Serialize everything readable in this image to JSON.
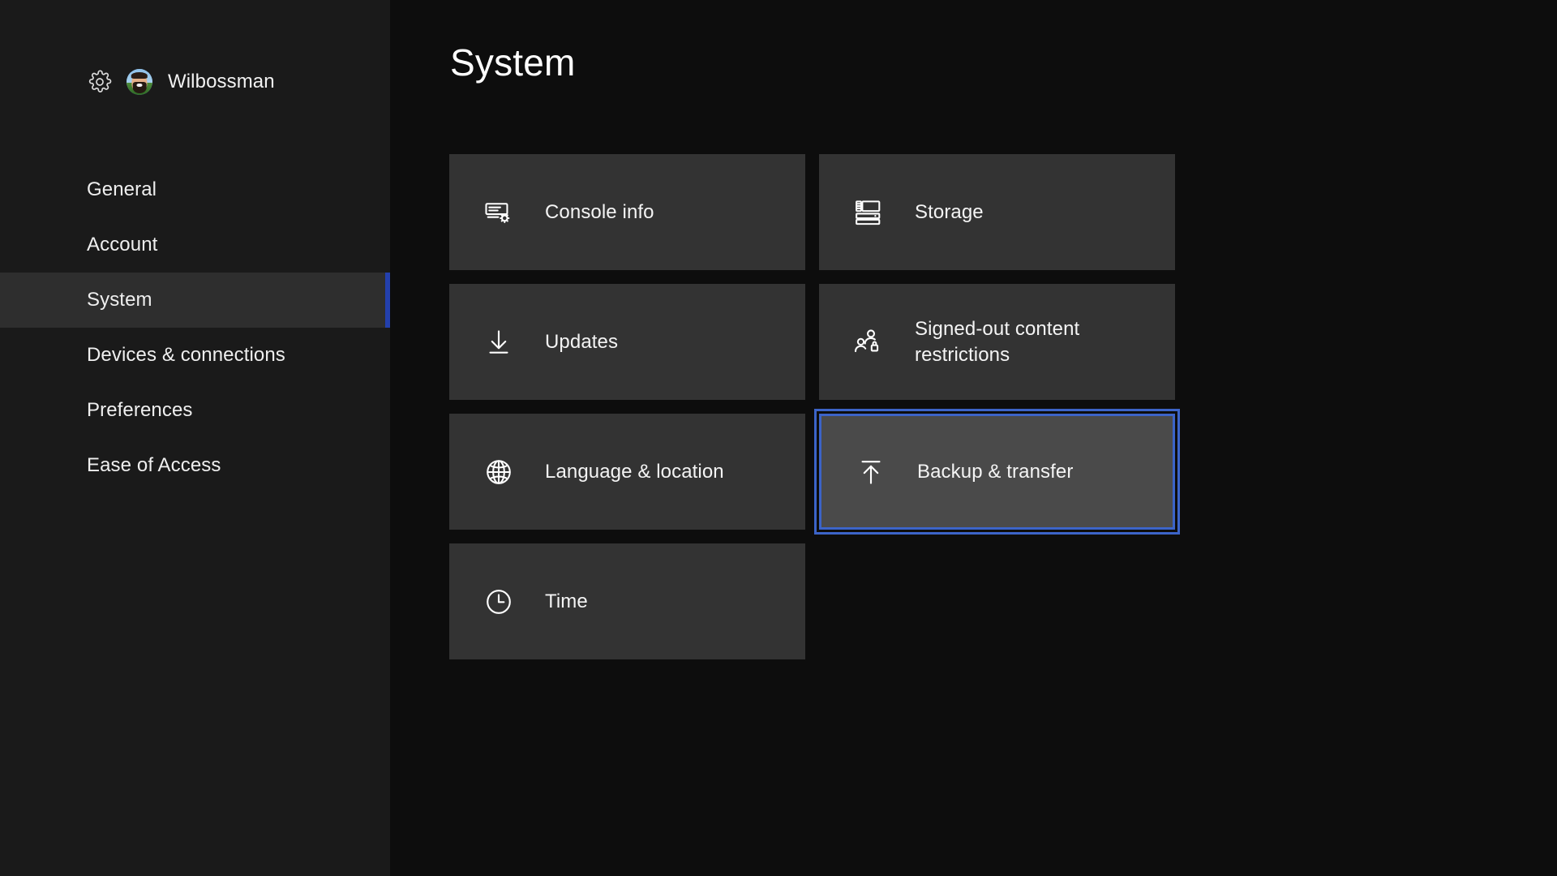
{
  "sidebar": {
    "settings_icon": "gear-icon",
    "avatar_icon": "user-avatar",
    "username": "Wilbossman",
    "items": [
      {
        "label": "General",
        "selected": false
      },
      {
        "label": "Account",
        "selected": false
      },
      {
        "label": "System",
        "selected": true
      },
      {
        "label": "Devices & connections",
        "selected": false
      },
      {
        "label": "Preferences",
        "selected": false
      },
      {
        "label": "Ease of Access",
        "selected": false
      }
    ]
  },
  "main": {
    "title": "System",
    "tiles": [
      {
        "label": "Console info",
        "icon": "console-info-icon",
        "focused": false
      },
      {
        "label": "Storage",
        "icon": "storage-icon",
        "focused": false
      },
      {
        "label": "Updates",
        "icon": "download-arrow-icon",
        "focused": false
      },
      {
        "label": "Signed-out content restrictions",
        "icon": "people-lock-icon",
        "focused": false
      },
      {
        "label": "Language & location",
        "icon": "globe-icon",
        "focused": false
      },
      {
        "label": "Backup & transfer",
        "icon": "upload-arrow-icon",
        "focused": true
      },
      {
        "label": "Time",
        "icon": "clock-icon",
        "focused": false
      }
    ]
  },
  "colors": {
    "app_background": "#0d0d0d",
    "sidebar_background": "#1a1a1a",
    "sidebar_selected_background": "#2e2e2e",
    "sidebar_accent": "#2340ad",
    "tile_background": "#333333",
    "tile_focused_background": "#4a4a4a",
    "focus_border": "#3c64c8",
    "text_primary": "#f4f4f4"
  }
}
